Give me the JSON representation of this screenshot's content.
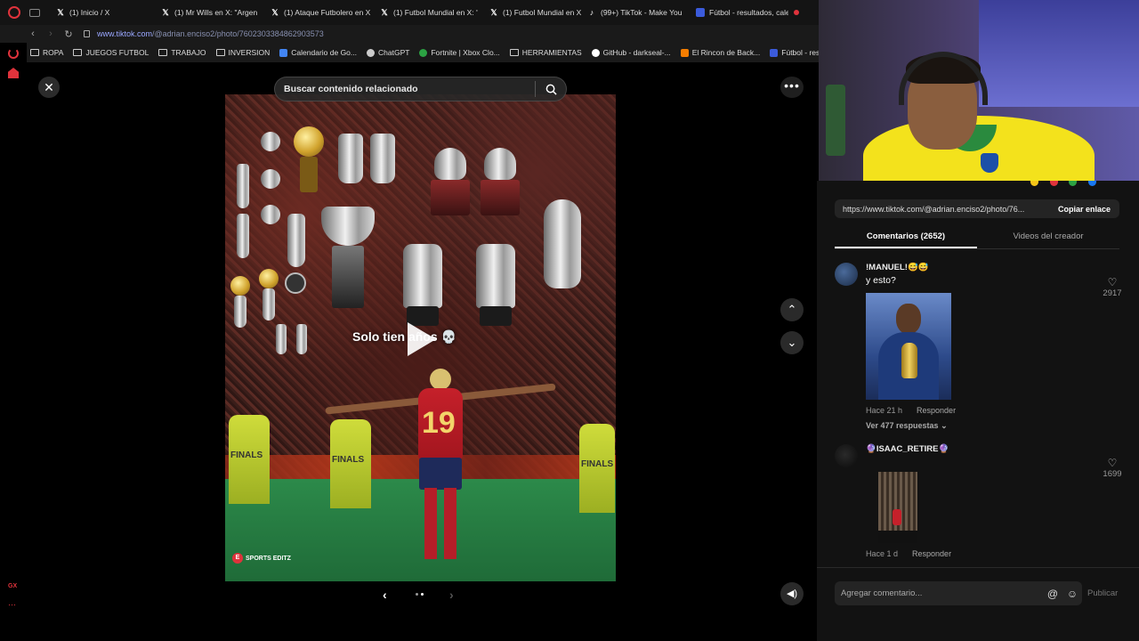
{
  "browser": {
    "tabs": [
      {
        "label": "(1) Inicio / X",
        "icon": "x-logo-icon"
      },
      {
        "label": "(1) Mr Wills en X: \"Argen",
        "icon": "x-logo-icon"
      },
      {
        "label": "(1) Ataque Futbolero en X",
        "icon": "x-logo-icon"
      },
      {
        "label": "(1) Futbol Mundial en X: '",
        "icon": "x-logo-icon"
      },
      {
        "label": "(1) Futbol Mundial en X:",
        "icon": "x-logo-icon"
      },
      {
        "label": "(99+) TikTok - Make You",
        "icon": "tiktok-icon"
      },
      {
        "label": "Fútbol - resultados, cale",
        "icon": "sports-site-icon"
      }
    ],
    "url_host": "www.tiktok.com",
    "url_path": "/@adrian.enciso2/photo/7602303384862903573",
    "bookmarks": [
      {
        "label": "ROPA",
        "icon": "folder-icon"
      },
      {
        "label": "JUEGOS FUTBOL",
        "icon": "folder-icon"
      },
      {
        "label": "TRABAJO",
        "icon": "folder-icon"
      },
      {
        "label": "INVERSION",
        "icon": "folder-icon"
      },
      {
        "label": "Calendario de Go...",
        "icon": "calendar-icon",
        "color": "#4285f4"
      },
      {
        "label": "ChatGPT",
        "icon": "chatgpt-icon",
        "color": "#cccccc"
      },
      {
        "label": "Fortnite | Xbox Clo...",
        "icon": "xbox-icon",
        "color": "#2ca243"
      },
      {
        "label": "HERRAMIENTAS",
        "icon": "folder-icon"
      },
      {
        "label": "GitHub - darkseal-...",
        "icon": "github-icon",
        "color": "#ffffff"
      },
      {
        "label": "El Rincon de Back...",
        "icon": "blogger-icon",
        "color": "#f57d00"
      },
      {
        "label": "Fútbol - resu",
        "icon": "sports-site-icon",
        "color": "#3b5bdb"
      }
    ],
    "sidebar_badge": "GX"
  },
  "viewer": {
    "search_placeholder": "Buscar contenido relacionado",
    "overlay_text": "Solo tien    años 💀",
    "shirt_number": "19",
    "steward_labels": [
      "FINALS",
      "FINALS",
      "FINALS"
    ],
    "watermark": "SPORTS EDITZ",
    "carousel": {
      "current": 1,
      "total": 2
    }
  },
  "panel": {
    "share_link": "https://www.tiktok.com/@adrian.enciso2/photo/76...",
    "copy_label": "Copiar enlace",
    "tabs": [
      {
        "label": "Comentarios (2652)",
        "active": true
      },
      {
        "label": "Videos del creador",
        "active": false
      }
    ],
    "comments": [
      {
        "author": "!MANUEL!😅😅",
        "text": "y esto?",
        "time": "Hace 21 h",
        "reply_label": "Responder",
        "replies_label": "Ver 477 respuestas",
        "likes": "2917"
      },
      {
        "author": "🔮ISAAC_RETIRE🔮",
        "text": "",
        "time": "Hace 1 d",
        "reply_label": "Responder",
        "likes": "1699"
      }
    ],
    "comment_placeholder": "Agregar comentario...",
    "publish_label": "Publicar"
  },
  "colors": {
    "opera_red": "#e0333c",
    "panel_bg": "#121212",
    "link_color": "#9aa7ff",
    "pitch_green": "#2c8a4a",
    "shirt_red": "#c5202a"
  }
}
